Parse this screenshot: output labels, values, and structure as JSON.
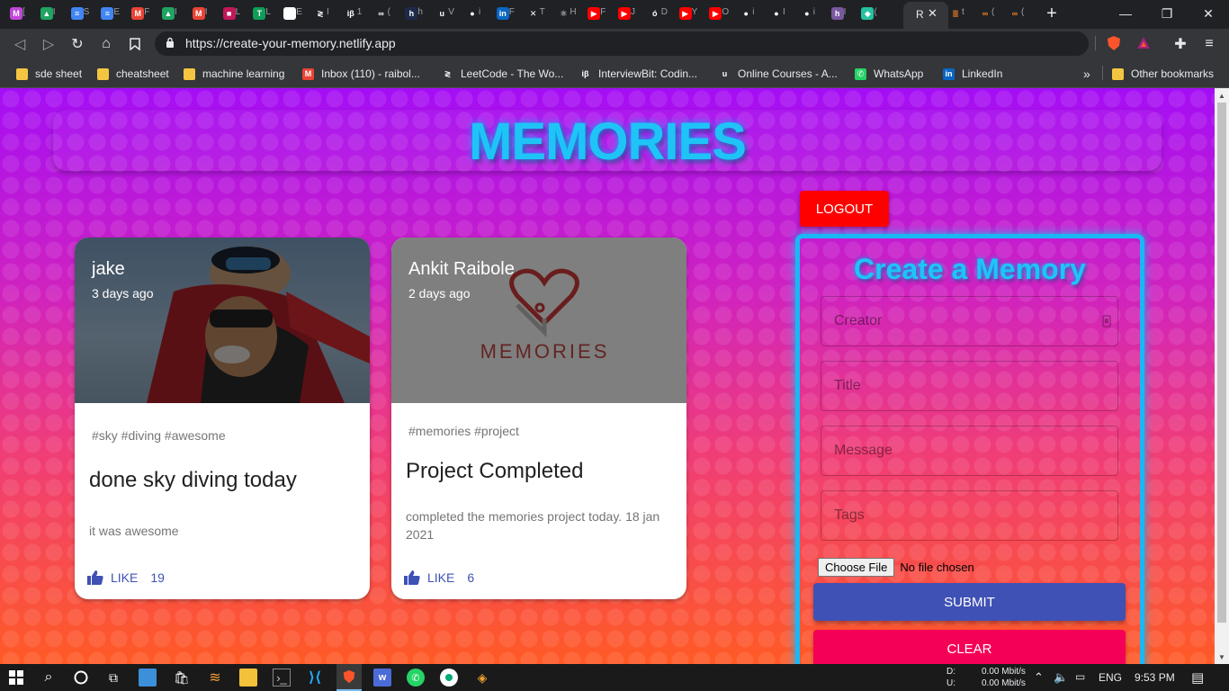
{
  "browser": {
    "tabs": [
      {
        "icon": "gmail-icon",
        "letter": "[",
        "color": "#c047d6",
        "glyph": "M"
      },
      {
        "icon": "google-drive-icon",
        "letter": "I",
        "color": "#1fa463",
        "glyph": "▲"
      },
      {
        "icon": "google-docs-icon",
        "letter": "S",
        "color": "#4285f4",
        "glyph": "≡"
      },
      {
        "icon": "google-docs-icon",
        "letter": "E",
        "color": "#4285f4",
        "glyph": "≡"
      },
      {
        "icon": "gmail-icon",
        "letter": "F",
        "color": "#ea4335",
        "glyph": "M"
      },
      {
        "icon": "google-drive-icon",
        "letter": "I",
        "color": "#1fa463",
        "glyph": "▲"
      },
      {
        "icon": "gmail-icon",
        "letter": "I",
        "color": "#ea4335",
        "glyph": "M"
      },
      {
        "icon": "contacts-icon",
        "letter": "L",
        "color": "#c2185b",
        "glyph": "■"
      },
      {
        "icon": "sheets-icon",
        "letter": "L",
        "color": "#0f9d58",
        "glyph": "T"
      },
      {
        "icon": "chart-icon",
        "letter": "E",
        "color": "#ffffff",
        "glyph": "↗"
      },
      {
        "icon": "leetcode-icon",
        "letter": "I",
        "color": "#202124",
        "glyph": "≷"
      },
      {
        "icon": "interviewbit-icon",
        "letter": "1",
        "color": "#202124",
        "glyph": "iβ"
      },
      {
        "icon": "geeksforgeeks-icon",
        "letter": "(",
        "color": "#202124",
        "glyph": "∞"
      },
      {
        "icon": "hackerrank-icon",
        "letter": "h",
        "color": "#1e2a4a",
        "glyph": "h"
      },
      {
        "icon": "udemy-icon",
        "letter": "V",
        "color": "#202124",
        "glyph": "u"
      },
      {
        "icon": "github-icon",
        "letter": "i",
        "color": "#202124",
        "glyph": "●"
      },
      {
        "icon": "linkedin-icon",
        "letter": "F",
        "color": "#0a66c2",
        "glyph": "in"
      },
      {
        "icon": "tool-icon",
        "letter": "T",
        "color": "#202124",
        "glyph": "✕"
      },
      {
        "icon": "react-icon",
        "letter": "H",
        "color": "#202124",
        "glyph": "⚛"
      },
      {
        "icon": "youtube-icon",
        "letter": "F",
        "color": "#ff0000",
        "glyph": "▶"
      },
      {
        "icon": "youtube-icon",
        "letter": "J",
        "color": "#ff0000",
        "glyph": "▶"
      },
      {
        "icon": "leaf-icon",
        "letter": "D",
        "color": "#202124",
        "glyph": "ó"
      },
      {
        "icon": "youtube-icon",
        "letter": "Y",
        "color": "#ff0000",
        "glyph": "▶"
      },
      {
        "icon": "youtube-icon",
        "letter": "O",
        "color": "#ff0000",
        "glyph": "▶"
      },
      {
        "icon": "github-icon",
        "letter": "i",
        "color": "#202124",
        "glyph": "●"
      },
      {
        "icon": "github-icon",
        "letter": "I",
        "color": "#202124",
        "glyph": "●"
      },
      {
        "icon": "github-icon",
        "letter": "i",
        "color": "#202124",
        "glyph": "●"
      },
      {
        "icon": "heroku-icon",
        "letter": "I",
        "color": "#79589f",
        "glyph": "h"
      },
      {
        "icon": "netlify-icon",
        "letter": "(",
        "color": "#25c2a0",
        "glyph": "◆"
      }
    ],
    "active_tab_letter": "R",
    "trailing_tabs": [
      {
        "icon": "stackoverflow-icon",
        "letter": "t",
        "color": "#202124",
        "glyph": "≣"
      },
      {
        "icon": "geeksforgeeks-icon",
        "letter": "(",
        "color": "#202124",
        "glyph": "∞"
      },
      {
        "icon": "geeksforgeeks-icon",
        "letter": "(",
        "color": "#202124",
        "glyph": "∞"
      }
    ],
    "url": "https://create-your-memory.netlify.app",
    "bookmarks": [
      {
        "label": "sde sheet",
        "icon": "folder-icon",
        "kind": "folder",
        "color": "#f5c542"
      },
      {
        "label": "cheatsheet",
        "icon": "folder-icon",
        "kind": "folder",
        "color": "#f5c542"
      },
      {
        "label": "machine learning",
        "icon": "folder-icon",
        "kind": "folder",
        "color": "#f5c542"
      },
      {
        "label": "Inbox (110) - raibol...",
        "icon": "gmail-icon",
        "kind": "site",
        "glyph": "M",
        "color": "#ea4335"
      },
      {
        "label": "LeetCode - The Wo...",
        "icon": "leetcode-icon",
        "kind": "site",
        "glyph": "≷",
        "color": "#35363a"
      },
      {
        "label": "InterviewBit: Codin...",
        "icon": "interviewbit-icon",
        "kind": "site",
        "glyph": "iβ",
        "color": "#35363a"
      },
      {
        "label": "Online Courses - A...",
        "icon": "udemy-icon",
        "kind": "site",
        "glyph": "u",
        "color": "#35363a"
      },
      {
        "label": "WhatsApp",
        "icon": "whatsapp-icon",
        "kind": "site",
        "glyph": "✆",
        "color": "#25d366"
      },
      {
        "label": "LinkedIn",
        "icon": "linkedin-icon",
        "kind": "site",
        "glyph": "in",
        "color": "#0a66c2"
      }
    ],
    "more_bookmarks": "»",
    "other_bookmarks": "Other bookmarks"
  },
  "app": {
    "title": "MEMORIES",
    "logout_label": "LOGOUT",
    "posts": [
      {
        "creator": "jake",
        "time": "3 days ago",
        "tags": "#sky #diving #awesome",
        "title": "done sky diving today",
        "message": "it was awesome",
        "like_label": "LIKE",
        "likes": "19"
      },
      {
        "creator": "Ankit Raibole",
        "time": "2 days ago",
        "tags": "#memories #project",
        "title": "Project Completed",
        "message": "completed the memories project today. 18 jan 2021",
        "like_label": "LIKE",
        "likes": "6",
        "logo_text": "MEMORIES"
      }
    ],
    "form": {
      "title": "Create a Memory",
      "creator_placeholder": "Creator",
      "title_placeholder": "Title",
      "message_placeholder": "Message",
      "tags_placeholder": "Tags",
      "choose_file_label": "Choose File",
      "no_file_text": "No file chosen",
      "submit_label": "SUBMIT",
      "clear_label": "CLEAR"
    }
  },
  "taskbar": {
    "net_down_label": "D:",
    "net_up_label": "U:",
    "net_down": "0.00 Mbit/s",
    "net_up": "0.00 Mbit/s",
    "language": "ENG",
    "time": "9:53 PM"
  },
  "colors": {
    "accent_cyan": "#1fc4f7",
    "logout_red": "#ff0000",
    "submit_blue": "#3f51b5",
    "clear_pink": "#f50057",
    "like_blue": "#3f51b5"
  }
}
